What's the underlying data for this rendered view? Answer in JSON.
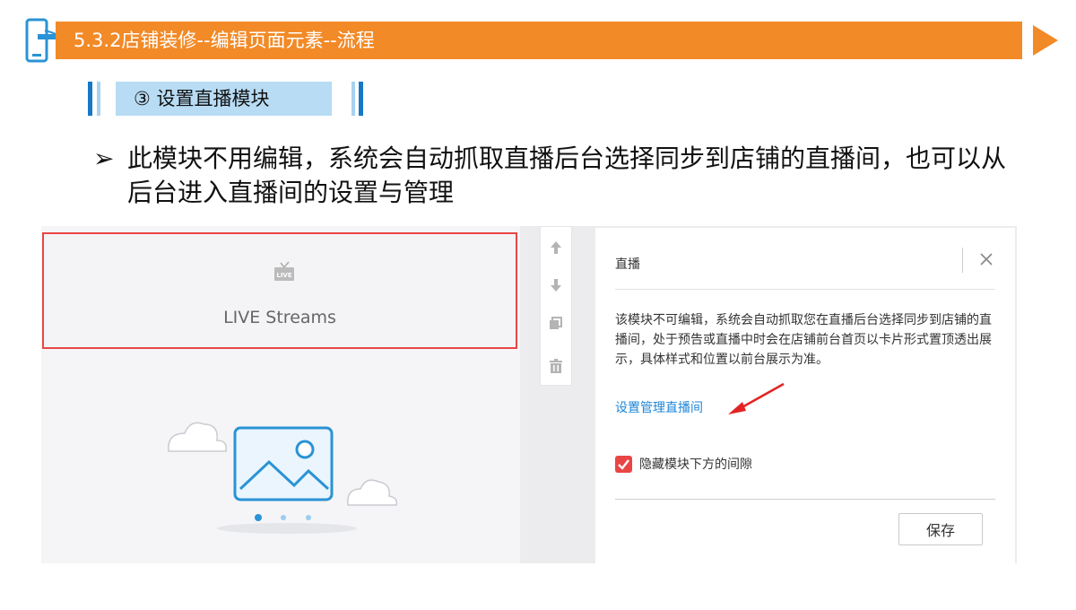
{
  "header": {
    "title": "5.3.2店铺装修--编辑页面元素--流程",
    "accent_color": "#f28a27",
    "icon": "phone-hand-icon"
  },
  "subheader": {
    "label": "③ 设置直播模块",
    "accent_color": "#b7dcf4"
  },
  "bullet": {
    "mark": "➢",
    "text": "此模块不用编辑，系统会自动抓取直播后台选择同步到店铺的直播间，也可以从后台进入直播间的设置与管理"
  },
  "preview": {
    "live_label": "LIVE Streams",
    "live_icon": "live-tv-icon",
    "highlight_color": "#e94545",
    "illustration": "image-placeholder-icon"
  },
  "toolbar": {
    "icons": [
      "arrow-up-icon",
      "arrow-down-icon",
      "copy-icon",
      "trash-icon"
    ]
  },
  "panel": {
    "title": "直播",
    "close_icon": "close-icon",
    "description": "该模块不可编辑，系统会自动抓取您在直播后台选择同步到店铺的直播间，处于预告或直播中时会在店铺前台首页以卡片形式置顶透出展示，具体样式和位置以前台展示为准。",
    "link_label": "设置管理直播间",
    "link_color": "#1e86d8",
    "checkbox": {
      "label": "隐藏模块下方的间隙",
      "checked": true
    },
    "save_label": "保存"
  }
}
